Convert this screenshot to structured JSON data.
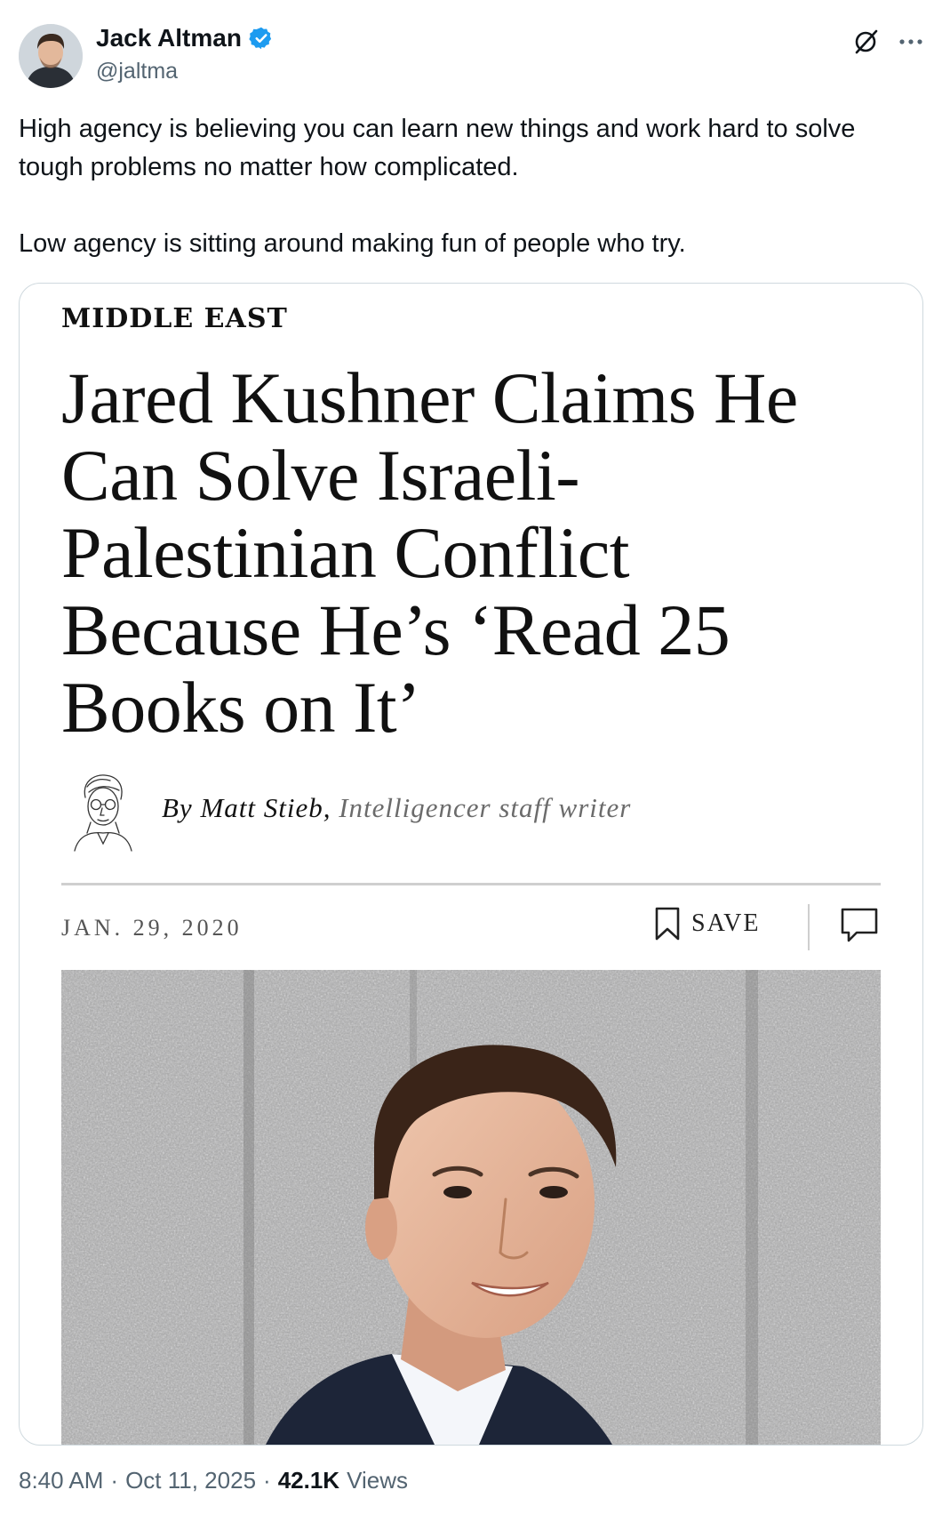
{
  "author": {
    "display_name": "Jack Altman",
    "handle": "@jaltma",
    "verified_color": "#1d9bf0"
  },
  "tweet": {
    "paragraphs": [
      "High agency is believing you can learn new things and work hard to solve tough problems no matter how complicated.",
      "Low agency is sitting around making fun of people who try."
    ]
  },
  "article": {
    "section": "MIDDLE EAST",
    "headline": "Jared Kushner Claims He Can Solve Israeli-Palestinian Conflict Because He’s ‘Read 25 Books on It’",
    "byline_prefix": "By Matt Stieb,",
    "byline_role": "Intelligencer staff writer",
    "date": "JAN. 29, 2020",
    "save_label": "SAVE"
  },
  "footer": {
    "time": "8:40 AM",
    "sep1": "·",
    "date": "Oct 11, 2025",
    "sep2": "·",
    "views_count": "42.1K",
    "views_label": "Views"
  },
  "icons": {
    "verified": "verified-badge-icon",
    "grok": "grok-icon",
    "more": "more-options-icon",
    "save": "bookmark-icon",
    "comment": "comment-icon"
  }
}
